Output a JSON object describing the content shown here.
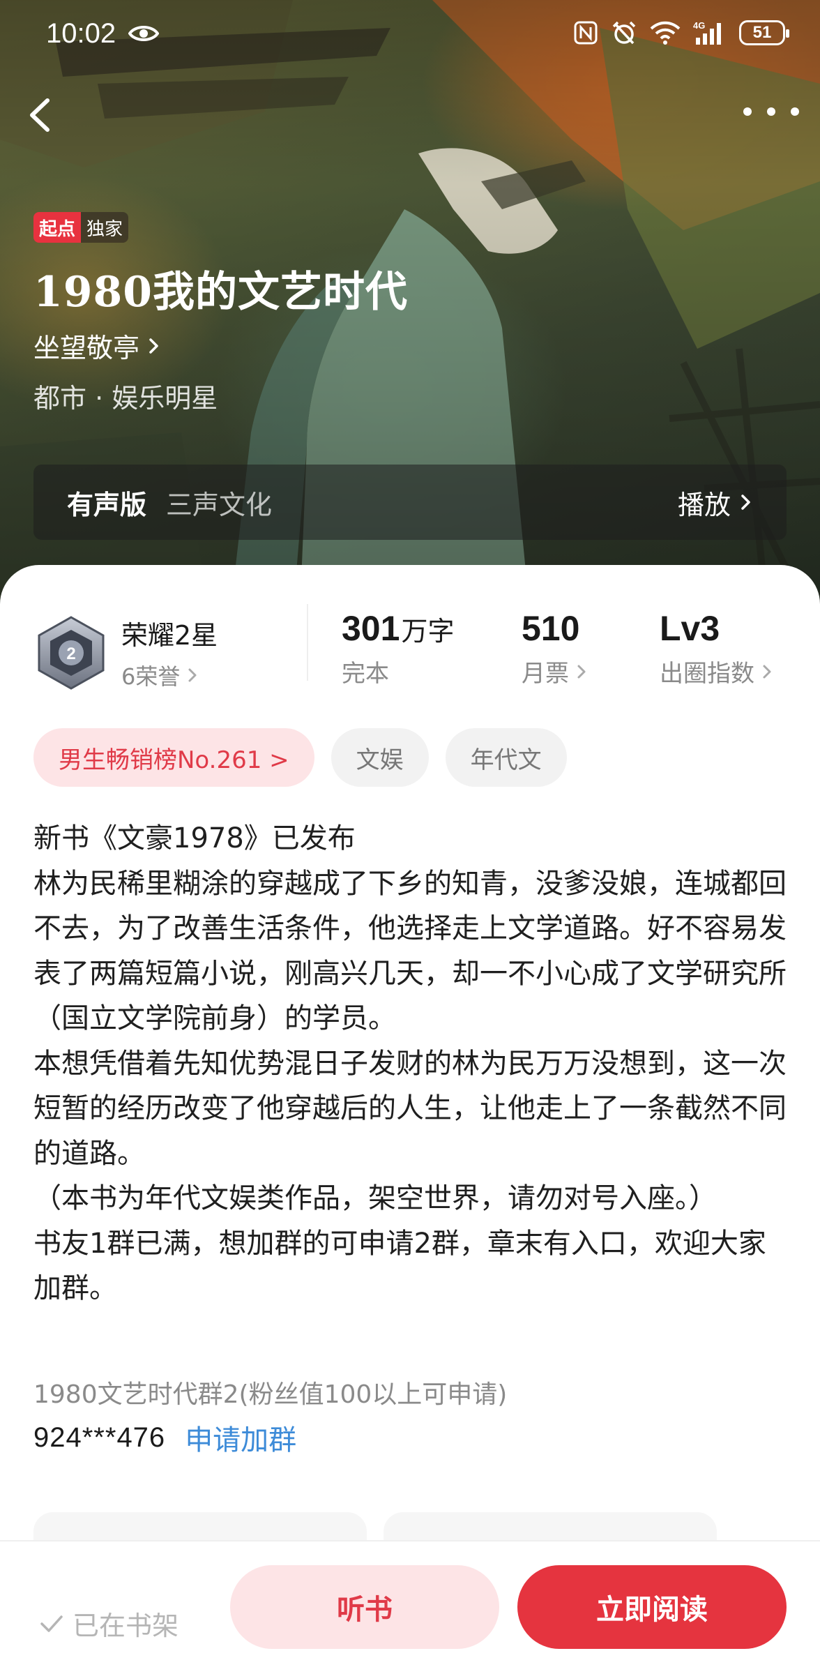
{
  "status_bar": {
    "time": "10:02",
    "battery": "51",
    "icons": [
      "eye-icon",
      "nfc-icon",
      "alarm-icon",
      "wifi-icon",
      "signal-4g-icon",
      "battery-icon"
    ]
  },
  "header": {
    "back_icon": "chevron-left-icon",
    "more_icon": "more-dots-icon"
  },
  "book": {
    "badge_brand": "起点",
    "badge_exclusive": "独家",
    "title": "1980我的文艺时代",
    "author": "坐望敬亭",
    "genre": "都市 · 娱乐明星"
  },
  "audio": {
    "label": "有声版",
    "publisher": "三声文化",
    "play": "播放"
  },
  "honor": {
    "title": "荣耀2星",
    "sub": "6荣誉"
  },
  "stats": [
    {
      "value": "301",
      "unit": "万字",
      "label": "完本"
    },
    {
      "value": "510",
      "unit": "",
      "label": "月票"
    },
    {
      "value": "Lv3",
      "unit": "",
      "label": "出圈指数"
    }
  ],
  "tags": [
    "男生畅销榜No.261 >",
    "文娱",
    "年代文"
  ],
  "intro": [
    "新书《文豪1978》已发布",
    "林为民稀里糊涂的穿越成了下乡的知青，没爹没娘，连城都回不去，为了改善生活条件，他选择走上文学道路。好不容易发表了两篇短篇小说，刚高兴几天，却一不小心成了文学研究所（国立文学院前身）的学员。",
    "本想凭借着先知优势混日子发财的林为民万万没想到，这一次短暂的经历改变了他穿越后的人生，让他走上了一条截然不同的道路。",
    "（本书为年代文娱类作品，架空世界，请勿对号入座。）",
    "书友1群已满，想加群的可申请2群，章末有入口，欢迎大家加群。"
  ],
  "group": {
    "name": "1980文艺时代群2(粉丝值100以上可申请)",
    "id": "924***476",
    "join": "申请加群"
  },
  "bottom": {
    "shelf": "已在书架",
    "listen": "听书",
    "read": "立即阅读"
  },
  "colors": {
    "accent": "#e5343f",
    "accent_light": "#fde4e6",
    "link": "#3d8bd8"
  }
}
